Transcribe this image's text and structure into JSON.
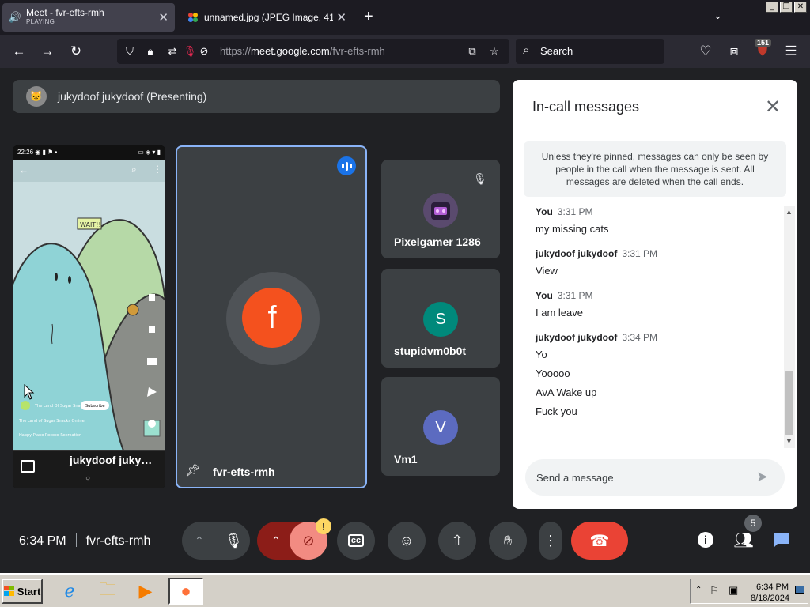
{
  "browser": {
    "tabs": [
      {
        "title": "Meet - fvr-efts-rmh",
        "subtitle": "PLAYING",
        "active": true,
        "icon": "meet-icon"
      },
      {
        "title": "unnamed.jpg (JPEG Image, 411 ×",
        "active": false,
        "icon": "photos-icon"
      }
    ],
    "url_prefix": "https://",
    "url_host": "meet.google.com",
    "url_path": "/fvr-efts-rmh",
    "search_label": "Search",
    "extension_badge": "151"
  },
  "meet": {
    "presenting_label": "jukydoof jukydoof (Presenting)",
    "share_tile": {
      "name": "jukydoof juky…",
      "phone_time": "22:26",
      "sign_text": "WAIT!!",
      "channel": "The Land Of Sugar Snacks",
      "subscribe": "Subscribe",
      "caption": "The Land of Sugar Snacks Online",
      "music": "Happy Piano Rococo Recreation"
    },
    "main_tile": {
      "name": "fvr-efts-rmh",
      "initial": "f",
      "avatar_color": "#f4511e"
    },
    "participants": [
      {
        "name": "Pixelgamer 1286",
        "initial": "",
        "avatar_color": "#7b5ea7",
        "muted": true
      },
      {
        "name": "stupidvm0b0t",
        "initial": "S",
        "avatar_color": "#00897b",
        "muted": false
      },
      {
        "name": "Vm1",
        "initial": "V",
        "avatar_color": "#5c6bc0",
        "muted": false
      }
    ],
    "chat": {
      "title": "In-call messages",
      "notice": "Unless they're pinned, messages can only be seen by people in the call when the message is sent. All messages are deleted when the call ends.",
      "messages": [
        {
          "sender": "You",
          "time": "3:31 PM",
          "lines": [
            "my missing cats"
          ]
        },
        {
          "sender": "jukydoof jukydoof",
          "time": "3:31 PM",
          "lines": [
            "View"
          ]
        },
        {
          "sender": "You",
          "time": "3:31 PM",
          "lines": [
            "I am leave"
          ]
        },
        {
          "sender": "jukydoof jukydoof",
          "time": "3:34 PM",
          "lines": [
            "Yo",
            "Yooooo",
            "AvA Wake up",
            "Fuck you"
          ]
        }
      ],
      "input_placeholder": "Send a message"
    },
    "footer": {
      "time": "6:34 PM",
      "meeting_code": "fvr-efts-rmh",
      "people_count": "5",
      "warning_badge": "!"
    }
  },
  "taskbar": {
    "start_label": "Start",
    "clock_time": "6:34 PM",
    "clock_date": "8/18/2024"
  }
}
